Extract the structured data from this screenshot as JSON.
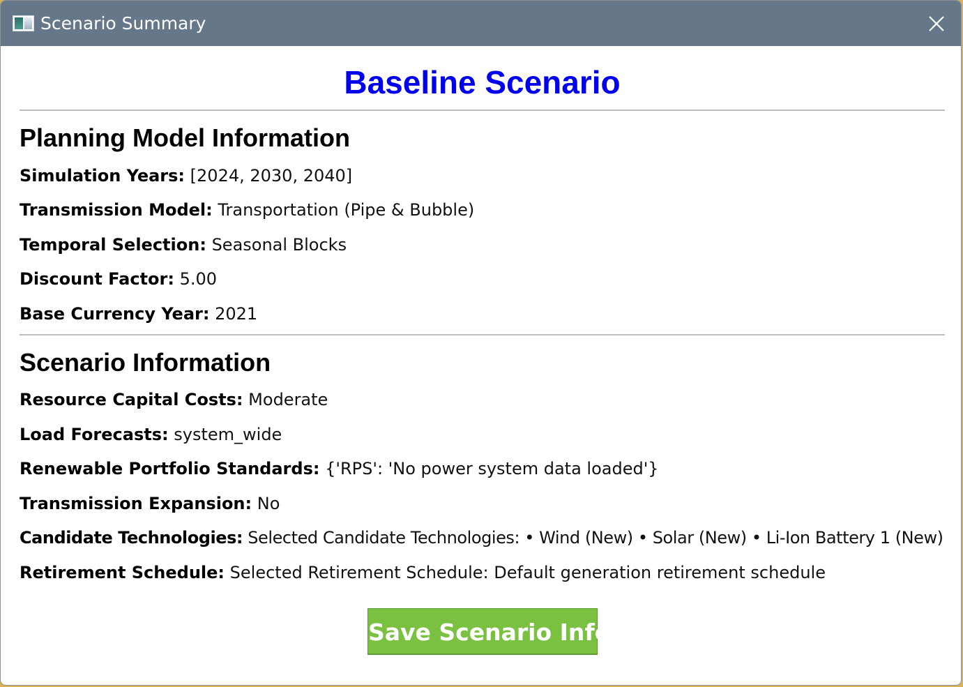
{
  "window": {
    "title": "Scenario Summary",
    "app_icon": "app-window-icon",
    "close_icon": "close-icon"
  },
  "scenario_title": "Baseline Scenario",
  "planning_model": {
    "heading": "Planning Model Information",
    "fields": [
      {
        "label": "Simulation Years:",
        "value": "[2024, 2030, 2040]"
      },
      {
        "label": "Transmission Model:",
        "value": "Transportation (Pipe & Bubble)"
      },
      {
        "label": "Temporal Selection:",
        "value": "Seasonal Blocks"
      },
      {
        "label": "Discount Factor:",
        "value": "5.00"
      },
      {
        "label": "Base Currency Year:",
        "value": "2021"
      }
    ]
  },
  "scenario_info": {
    "heading": "Scenario Information",
    "fields": [
      {
        "label": "Resource Capital Costs:",
        "value": "Moderate"
      },
      {
        "label": "Load Forecasts:",
        "value": "system_wide"
      },
      {
        "label": "Renewable Portfolio Standards:",
        "value": "{'RPS': 'No power system data loaded'}"
      },
      {
        "label": "Transmission Expansion:",
        "value": "No"
      },
      {
        "label": "Candidate Technologies:",
        "value": "Selected Candidate Technologies: • Wind (New) • Solar (New) • Li-Ion Battery 1 (New)"
      },
      {
        "label": "Retirement Schedule:",
        "value": "Selected Retirement Schedule: Default generation retirement schedule"
      }
    ]
  },
  "save_button_label": "Save Scenario Info",
  "colors": {
    "titlebar": "#67778a",
    "scenario_title": "#0000ee",
    "save_button": "#7ac142"
  }
}
